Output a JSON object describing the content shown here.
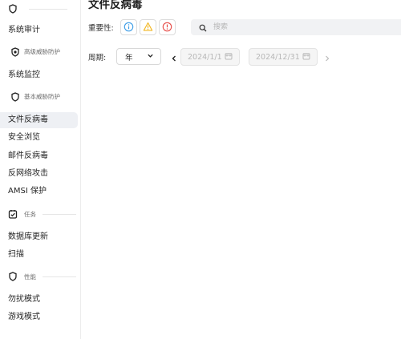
{
  "sidebar": {
    "top_group_icon": "shield-icon",
    "items": [
      {
        "label": "系统审计",
        "type": "item"
      },
      {
        "label": "高级威胁防护",
        "type": "subgroup",
        "icon": "shield-dot-icon"
      },
      {
        "label": "系统监控",
        "type": "item"
      },
      {
        "label": "基本威胁防护",
        "type": "group",
        "icon": "shield-icon"
      },
      {
        "label": "文件反病毒",
        "type": "item",
        "active": true
      },
      {
        "label": "安全浏览",
        "type": "item"
      },
      {
        "label": "邮件反病毒",
        "type": "item"
      },
      {
        "label": "反网络攻击",
        "type": "item"
      },
      {
        "label": "AMSI 保护",
        "type": "item"
      },
      {
        "label": "任务",
        "type": "group",
        "icon": "task-icon"
      },
      {
        "label": "数据库更新",
        "type": "item"
      },
      {
        "label": "扫描",
        "type": "item"
      },
      {
        "label": "性能",
        "type": "group",
        "icon": "shield-icon"
      },
      {
        "label": "勿扰模式",
        "type": "item"
      },
      {
        "label": "游戏模式",
        "type": "item"
      }
    ]
  },
  "page": {
    "title": "文件反病毒"
  },
  "filters": {
    "severity_label": "重要性:",
    "severity_buttons": [
      "info-circle-icon",
      "warning-triangle-icon",
      "error-circle-icon"
    ],
    "search_placeholder": "搜索",
    "period_label": "周期:",
    "period_value": "年",
    "date_start": "2024/1/1",
    "date_end": "2024/12/31"
  },
  "colors": {
    "info": "#3b9ce6",
    "warning": "#f2b51d",
    "error": "#e64a45",
    "active_bg": "#eef0f4"
  }
}
